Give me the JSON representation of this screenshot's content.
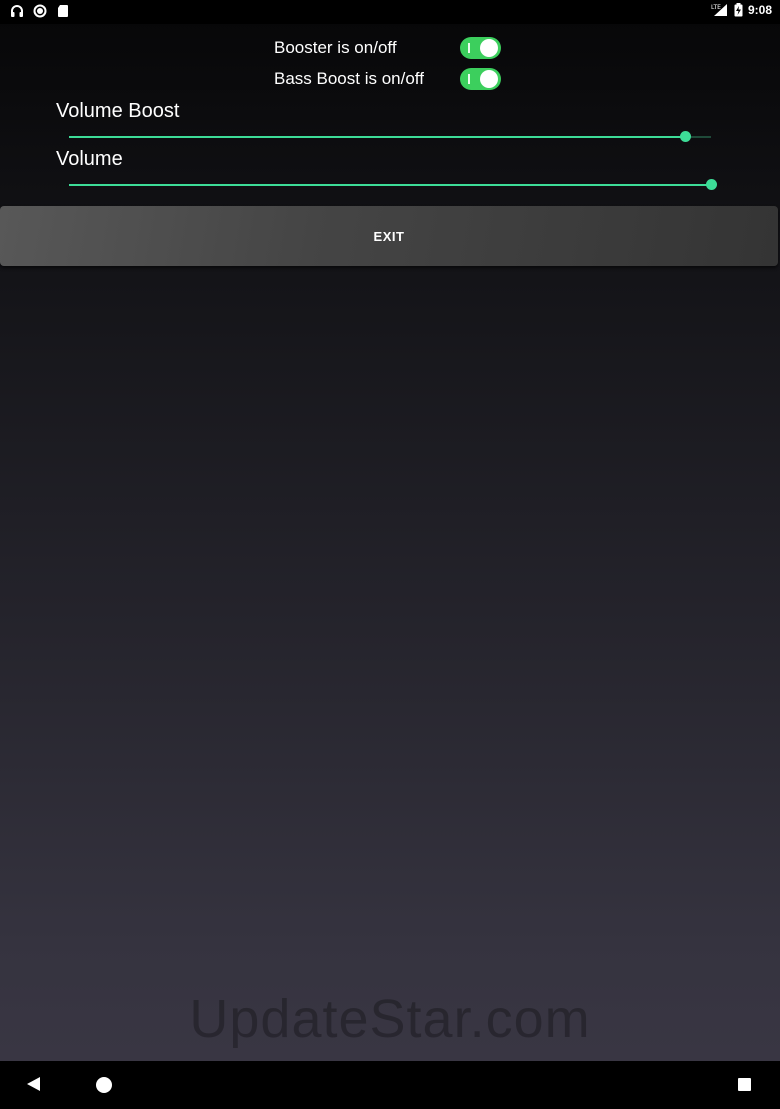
{
  "status_bar": {
    "time": "9:08",
    "network_type": "LTE",
    "left_icons": [
      "headset-icon",
      "circle-record-icon",
      "sd-card-icon"
    ],
    "right_icons": [
      "signal-icon",
      "battery-charging-icon"
    ]
  },
  "toggles": [
    {
      "label": "Booster is on/off",
      "state": "on"
    },
    {
      "label": "Bass Boost is on/off",
      "state": "on"
    }
  ],
  "sliders": [
    {
      "label": "Volume Boost",
      "value_fraction": 0.96
    },
    {
      "label": "Volume",
      "value_fraction": 1.0
    }
  ],
  "exit_button": {
    "label": "EXIT"
  },
  "watermark": "UpdateStar.com",
  "colors": {
    "accent": "#3ddc97",
    "switch_on": "#3ccf5d",
    "button": "#454545"
  },
  "nav": {
    "icons": [
      "back-icon",
      "home-icon",
      "recents-icon"
    ]
  }
}
